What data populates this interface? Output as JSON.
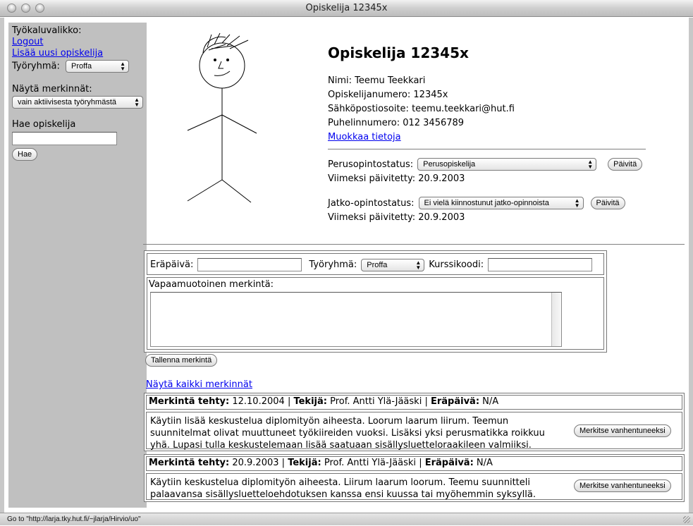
{
  "window": {
    "title": "Opiskelija 12345x"
  },
  "sidebar": {
    "toolbox_label": "Työkaluvalikko:",
    "logout_link": "Logout",
    "add_student_link": "Lisää uusi opiskelija",
    "workgroup_label": "Työryhmä:",
    "workgroup_value": "Proffa",
    "show_entries_label": "Näytä merkinnät:",
    "show_entries_value": "vain aktiivisesta työryhmästä",
    "search_label": "Hae opiskelija",
    "search_value": "",
    "search_button": "Hae"
  },
  "profile": {
    "title": "Opiskelija 12345x",
    "name_line": "Nimi: Teemu Teekkari",
    "number_line": "Opiskelijanumero: 12345x",
    "email_line": "Sähköpostiosoite: teemu.teekkari@hut.fi",
    "phone_line": "Puhelinnumero: 012 3456789",
    "edit_link": "Muokkaa tietoja",
    "basic_status_label": "Perusopintostatus:",
    "basic_status_value": "Perusopiskelija",
    "basic_update_button": "Päivitä",
    "basic_updated": "Viimeksi päivitetty: 20.9.2003",
    "grad_status_label": "Jatko-opintostatus:",
    "grad_status_value": "Ei vielä kiinnostunut jatko-opinnoista",
    "grad_update_button": "Päivitä",
    "grad_updated": "Viimeksi päivitetty: 20.9.2003"
  },
  "entry_form": {
    "due_label": "Eräpäivä:",
    "due_value": "",
    "group_label": "Työryhmä:",
    "group_value": "Proffa",
    "course_label": "Kurssikoodi:",
    "course_value": "",
    "free_label": "Vapaamuotoinen merkintä:",
    "free_value": "",
    "save_button": "Tallenna merkintä"
  },
  "show_all_link": "Näytä kaikki merkinnät",
  "entries": [
    {
      "made_label": "Merkintä tehty:",
      "made_value": "12.10.2004",
      "sep1": "|",
      "author_label": "Tekijä:",
      "author_value": "Prof. Antti Ylä-Jääski",
      "sep2": "|",
      "due_label": "Eräpäivä:",
      "due_value": "N/A",
      "line1": "Käytiin lisää keskustelua diplomityön aiheesta. Loorum laarum liirum. Teemun",
      "line2": "suunnitelmat olivat muuttuneet työkiireiden vuoksi. Lisäksi yksi perusmatikka roikkuu",
      "line3": "yhä. Lupasi tulla keskustelemaan lisää saatuaan sisällysluetteloraakileen valmiiksi.",
      "expire_button": "Merkitse vanhentuneeksi"
    },
    {
      "made_label": "Merkintä tehty:",
      "made_value": "20.9.2003",
      "sep1": "|",
      "author_label": "Tekijä:",
      "author_value": "Prof. Antti Ylä-Jääski",
      "sep2": "|",
      "due_label": "Eräpäivä:",
      "due_value": "N/A",
      "line1": "Käytiin keskustelua diplomityön aiheesta. Liirum laarum loorum. Teemu suunnitteli",
      "line2": "palaavansa sisällysluetteloehdotuksen kanssa ensi kuussa tai myöhemmin syksyllä.",
      "expire_button": "Merkitse vanhentuneeksi"
    }
  ],
  "statusbar": {
    "text": "Go to \"http://larja.tky.hut.fi/~jlarja/Hirvio/uo\""
  }
}
